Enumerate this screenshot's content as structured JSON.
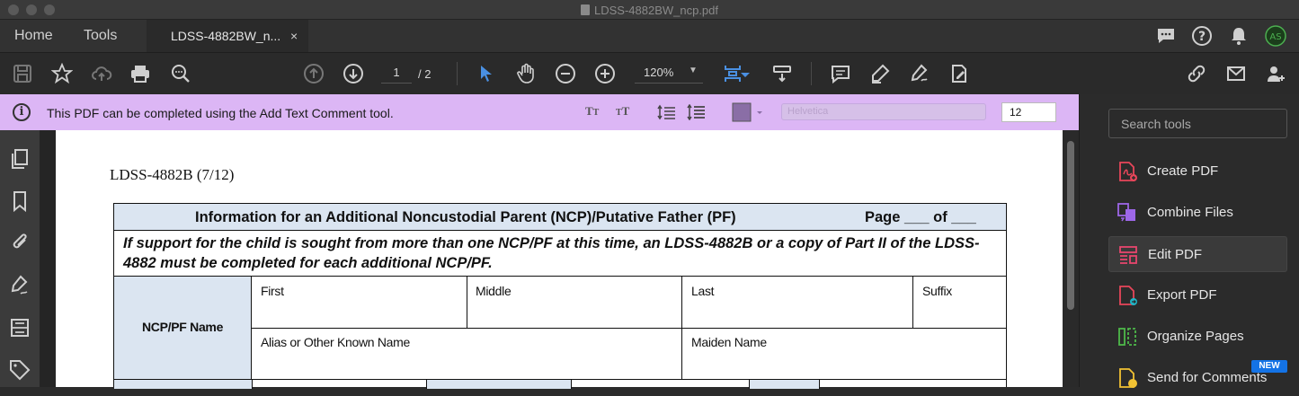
{
  "window": {
    "title": "LDSS-4882BW_ncp.pdf"
  },
  "nav": {
    "home": "Home",
    "tools": "Tools",
    "doc_tab": "LDSS-4882BW_n...",
    "close": "×"
  },
  "toolbar": {
    "page_current": "1",
    "page_total": "/ 2",
    "zoom": "120%"
  },
  "infobar": {
    "message": "This PDF can be completed using the Add Text Comment tool.",
    "font_placeholder": "Helvetica",
    "font_size": "12"
  },
  "document": {
    "form_id": "LDSS-4882B (7/12)",
    "header_title": "Information for an Additional Noncustodial Parent (NCP)/Putative Father (PF)",
    "header_page": "Page ___ of ___",
    "note": "If support for the child is sought from more than one NCP/PF at this time, an LDSS-4882B or a copy of Part II of the LDSS-4882 must be completed for each additional NCP/PF.",
    "name_label": "NCP/PF Name",
    "fields": {
      "first": "First",
      "middle": "Middle",
      "last": "Last",
      "suffix": "Suffix",
      "alias": "Alias or Other Known Name",
      "maiden": "Maiden Name"
    }
  },
  "rightpanel": {
    "search_placeholder": "Search tools",
    "tools": [
      {
        "label": "Create PDF",
        "icon": "create-pdf-icon",
        "color": "#e8465a"
      },
      {
        "label": "Combine Files",
        "icon": "combine-files-icon",
        "color": "#9d67e8"
      },
      {
        "label": "Edit PDF",
        "icon": "edit-pdf-icon",
        "color": "#e8466e"
      },
      {
        "label": "Export PDF",
        "icon": "export-pdf-icon",
        "color": "#1fb5c6"
      },
      {
        "label": "Organize Pages",
        "icon": "organize-pages-icon",
        "color": "#4eb84a"
      },
      {
        "label": "Send for Comments",
        "icon": "send-for-comments-icon",
        "color": "#f2c233"
      }
    ],
    "new_badge": "NEW"
  },
  "colors": {
    "infobar_bg": "#dcb6f5",
    "form_header_bg": "#dbe5f1",
    "accent_blue": "#4a90e2"
  }
}
